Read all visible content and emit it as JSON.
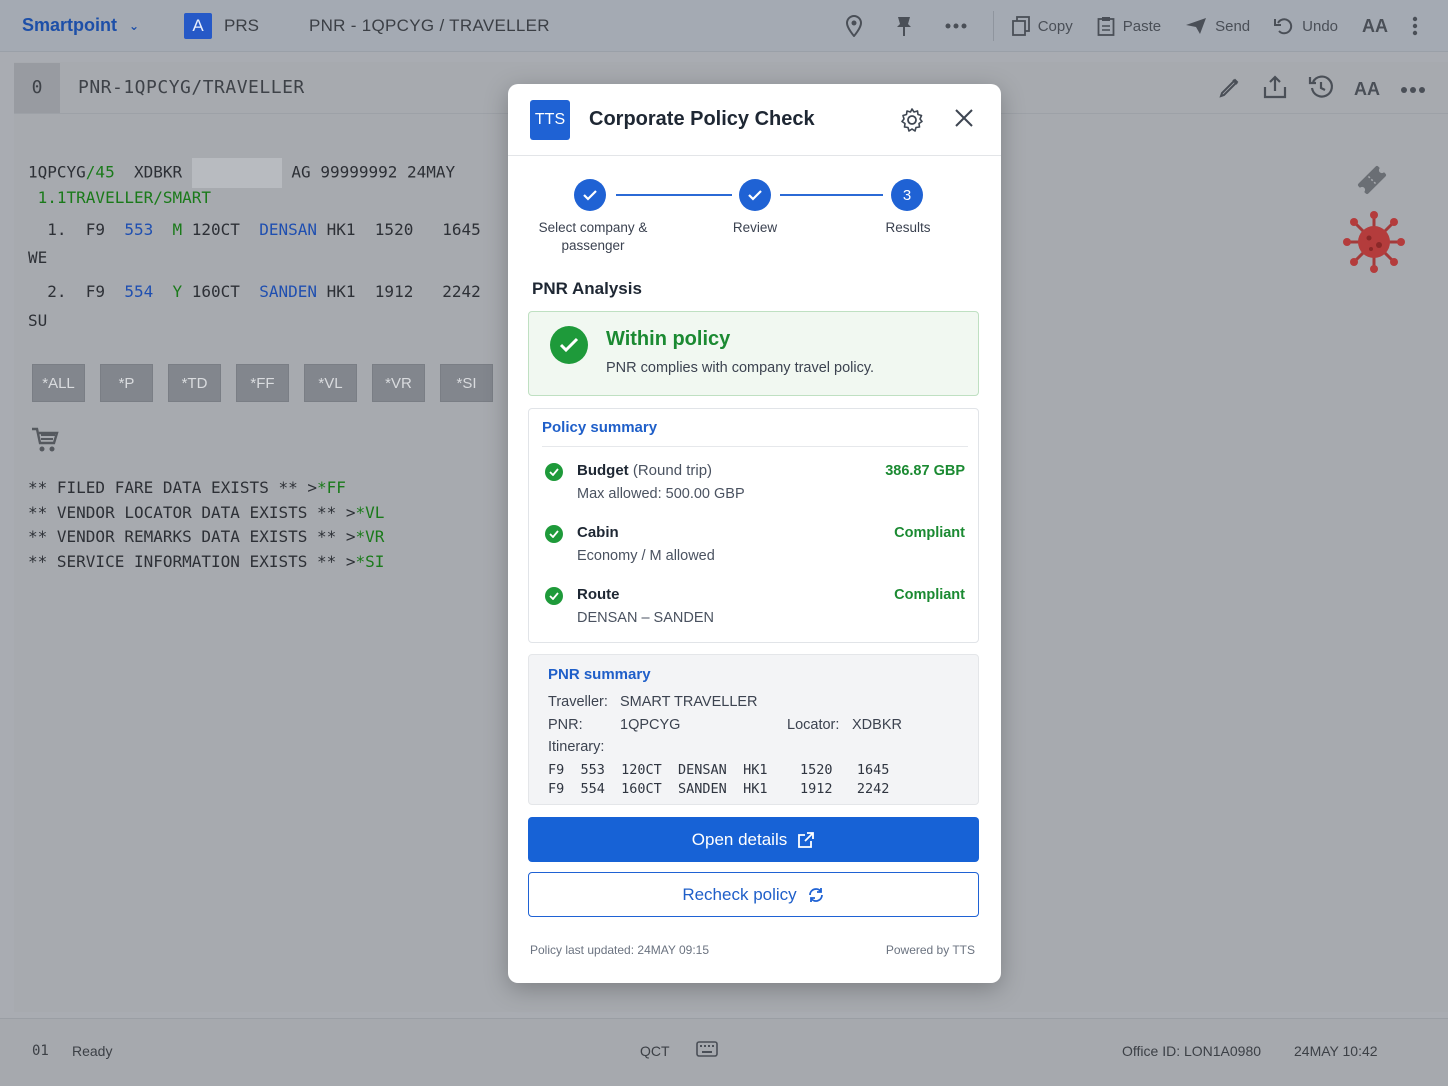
{
  "topbar": {
    "brand": "Smartpoint",
    "prs_letter": "A",
    "prs_label": "PRS",
    "tab_title": "PNR - 1QPCYG / TRAVELLER",
    "copy": "Copy",
    "paste": "Paste",
    "send": "Send",
    "undo": "Undo",
    "aa": "AA"
  },
  "terminal": {
    "num": "0",
    "title": "PNR-1QPCYG/TRAVELLER",
    "aa": "AA",
    "line1_a": "1QPCYG",
    "line1_b": "/45",
    "line1_c": "  XDBKR",
    "line1_d": "AG 99999992 24MAY",
    "line2": " 1.1TRAVELLER/SMART",
    "seg1": {
      "num": "  1.  F9  ",
      "flight": "553",
      "cls": "M",
      "date": " 120CT  ",
      "city": "DENSAN",
      "rest": " HK1  1520   1645",
      "day": "WE"
    },
    "seg2": {
      "num": "  2.  F9  ",
      "flight": "554",
      "cls": "Y",
      "date": " 160CT  ",
      "city": "SANDEN",
      "rest": " HK1  1912   2242",
      "day": "SU"
    },
    "commands": [
      "*ALL",
      "*P",
      "*TD",
      "*FF",
      "*VL",
      "*VR",
      "*SI"
    ],
    "info": [
      {
        "text": "** FILED FARE DATA EXISTS ** >",
        "cmd": "*FF"
      },
      {
        "text": "** VENDOR LOCATOR DATA EXISTS ** >",
        "cmd": "*VL"
      },
      {
        "text": "** VENDOR REMARKS DATA EXISTS ** >",
        "cmd": "*VR"
      },
      {
        "text": "** SERVICE INFORMATION EXISTS ** >",
        "cmd": "*SI"
      }
    ]
  },
  "status": {
    "num": "01",
    "state": "Ready",
    "qct": "QCT",
    "office": "Office ID: LON1A0980",
    "datetime": "24MAY  10:42"
  },
  "modal": {
    "logo": "TTS",
    "title": "Corporate Policy Check",
    "steps": [
      {
        "label": "Select company & passenger"
      },
      {
        "label": "Review"
      },
      {
        "label": "Results",
        "num": "3"
      }
    ],
    "analysis_title": "PNR Analysis",
    "result_title": "Within policy",
    "result_sub": "PNR complies with company travel policy.",
    "policy_summary": {
      "title": "Policy summary",
      "items": [
        {
          "name": "Budget",
          "qual": "(Round trip)",
          "detail": "Max allowed: 500.00 GBP",
          "value": "386.87 GBP"
        },
        {
          "name": "Cabin",
          "qual": "",
          "detail": "Economy / M allowed",
          "value": "Compliant"
        },
        {
          "name": "Route",
          "qual": "",
          "detail": "DENSAN – SANDEN",
          "value": "Compliant"
        }
      ]
    },
    "pnr_summary": {
      "title": "PNR summary",
      "traveller_label": "Traveller:",
      "traveller": "SMART TRAVELLER",
      "pnr_label": "PNR:",
      "pnr": "1QPCYG",
      "locator_label": "Locator:",
      "locator": "XDBKR",
      "itinerary_label": "Itinerary:",
      "itinerary": [
        "F9  553  120CT  DENSAN  HK1    1520   1645",
        "F9  554  160CT  SANDEN  HK1    1912   2242"
      ]
    },
    "open_details": "Open details",
    "recheck": "Recheck policy",
    "footer_left": "Policy last updated: 24MAY 09:15",
    "footer_right": "Powered by TTS"
  },
  "colors": {
    "accent": "#1f62d4",
    "success": "#1e9a3a",
    "terminal_green": "#1a7a1a",
    "terminal_blue": "#1f4fb0"
  }
}
